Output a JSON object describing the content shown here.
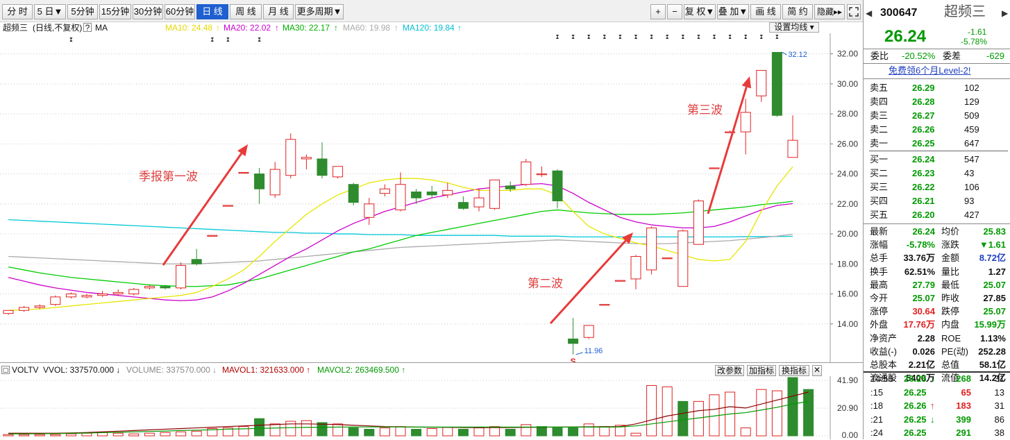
{
  "toolbar": {
    "periods": [
      "分 时",
      "5 日▼",
      "5分钟",
      "15分钟",
      "30分钟",
      "60分钟",
      "日 线",
      "周 线",
      "月 线",
      "更多周期▼"
    ],
    "active_period": "日 线",
    "right_buttons": [
      "+",
      "−",
      "复 权▼",
      "叠 加▼",
      "画 线",
      "简 约",
      "隐藏▸▸"
    ],
    "fullscreen_icon": "fullscreen-icon"
  },
  "chart_header": {
    "name": "超频三",
    "mode": "(日线,不复权)",
    "help": "?",
    "ma_label": "MA",
    "ma10": "MA10: 24.48",
    "ma20": "MA20: 22.02",
    "ma30": "MA30: 22.17",
    "ma60": "MA60: 19.98",
    "ma120": "MA120: 19.84",
    "set_ma": "设置均线"
  },
  "colors": {
    "up": "#e02020",
    "down": "#2e8b2e",
    "ma10": "#e6e600",
    "ma20": "#cc00cc",
    "ma30": "#00cc00",
    "ma60": "#aaaaaa",
    "ma120": "#00c8d8",
    "arrow": "#e83a3a"
  },
  "chart_data": {
    "type": "candlestick",
    "y_ticks": [
      "32.00",
      "30.00",
      "28.00",
      "26.00",
      "24.00",
      "22.00",
      "20.00",
      "18.00",
      "16.00",
      "14.00"
    ],
    "ylim": [
      12.0,
      33.0
    ],
    "candles": [
      {
        "o": 14.7,
        "h": 14.9,
        "l": 14.6,
        "c": 14.9
      },
      {
        "o": 14.9,
        "h": 15.2,
        "l": 14.8,
        "c": 15.1
      },
      {
        "o": 15.1,
        "h": 15.3,
        "l": 15.0,
        "c": 15.2
      },
      {
        "o": 15.3,
        "h": 15.9,
        "l": 15.2,
        "c": 15.8
      },
      {
        "o": 15.8,
        "h": 16.1,
        "l": 15.7,
        "c": 16.0
      },
      {
        "o": 15.8,
        "h": 16.0,
        "l": 15.7,
        "c": 15.9
      },
      {
        "o": 15.9,
        "h": 16.2,
        "l": 15.8,
        "c": 16.0
      },
      {
        "o": 16.0,
        "h": 16.3,
        "l": 15.9,
        "c": 16.1
      },
      {
        "o": 16.0,
        "h": 16.4,
        "l": 15.9,
        "c": 16.3
      },
      {
        "o": 16.4,
        "h": 16.6,
        "l": 16.3,
        "c": 16.5
      },
      {
        "o": 16.5,
        "h": 16.6,
        "l": 16.3,
        "c": 16.4
      },
      {
        "o": 16.4,
        "h": 18.1,
        "l": 16.3,
        "c": 17.9
      },
      {
        "o": 18.3,
        "h": 19.0,
        "l": 17.9,
        "c": 18.0
      },
      {
        "o": 19.9,
        "h": 19.9,
        "l": 19.9,
        "c": 19.9
      },
      {
        "o": 21.9,
        "h": 21.9,
        "l": 21.9,
        "c": 21.9
      },
      {
        "o": 24.1,
        "h": 24.1,
        "l": 24.1,
        "c": 24.1
      },
      {
        "o": 24.0,
        "h": 24.4,
        "l": 22.0,
        "c": 23.0
      },
      {
        "o": 22.6,
        "h": 24.8,
        "l": 22.4,
        "c": 24.3
      },
      {
        "o": 23.9,
        "h": 26.7,
        "l": 23.7,
        "c": 26.3
      },
      {
        "o": 25.0,
        "h": 25.3,
        "l": 24.3,
        "c": 25.1
      },
      {
        "o": 25.0,
        "h": 26.1,
        "l": 23.7,
        "c": 23.9
      },
      {
        "o": 23.8,
        "h": 24.5,
        "l": 23.7,
        "c": 24.5
      },
      {
        "o": 23.3,
        "h": 23.4,
        "l": 21.9,
        "c": 22.1
      },
      {
        "o": 21.1,
        "h": 22.4,
        "l": 20.6,
        "c": 22.0
      },
      {
        "o": 22.7,
        "h": 23.3,
        "l": 22.5,
        "c": 23.0
      },
      {
        "o": 21.6,
        "h": 24.1,
        "l": 21.5,
        "c": 23.3
      },
      {
        "o": 22.8,
        "h": 23.0,
        "l": 22.0,
        "c": 22.4
      },
      {
        "o": 22.8,
        "h": 23.2,
        "l": 22.4,
        "c": 22.6
      },
      {
        "o": 22.6,
        "h": 23.4,
        "l": 22.4,
        "c": 22.9
      },
      {
        "o": 22.1,
        "h": 22.5,
        "l": 21.6,
        "c": 21.7
      },
      {
        "o": 21.8,
        "h": 23.0,
        "l": 21.5,
        "c": 22.4
      },
      {
        "o": 21.7,
        "h": 23.6,
        "l": 21.6,
        "c": 23.6
      },
      {
        "o": 23.2,
        "h": 23.5,
        "l": 22.8,
        "c": 23.0
      },
      {
        "o": 23.3,
        "h": 25.0,
        "l": 23.2,
        "c": 24.8
      },
      {
        "o": 24.0,
        "h": 24.5,
        "l": 23.8,
        "c": 24.0
      },
      {
        "o": 24.2,
        "h": 24.3,
        "l": 21.7,
        "c": 22.2
      },
      {
        "o": 13.0,
        "h": 14.4,
        "l": 11.96,
        "c": 12.7
      },
      {
        "o": 13.1,
        "h": 13.9,
        "l": 13.0,
        "c": 13.9
      },
      {
        "o": 15.3,
        "h": 15.3,
        "l": 15.3,
        "c": 15.3
      },
      {
        "o": 16.9,
        "h": 16.9,
        "l": 16.9,
        "c": 16.9
      },
      {
        "o": 17.0,
        "h": 18.6,
        "l": 16.3,
        "c": 18.5
      },
      {
        "o": 17.6,
        "h": 20.5,
        "l": 17.3,
        "c": 20.4
      },
      {
        "o": 18.4,
        "h": 18.4,
        "l": 18.4,
        "c": 18.4
      },
      {
        "o": 16.5,
        "h": 20.3,
        "l": 16.5,
        "c": 20.2
      },
      {
        "o": 19.3,
        "h": 22.3,
        "l": 19.3,
        "c": 22.2
      },
      {
        "o": 24.4,
        "h": 24.4,
        "l": 24.4,
        "c": 24.4
      },
      {
        "o": 26.8,
        "h": 26.9,
        "l": 26.8,
        "c": 26.8
      },
      {
        "o": 26.8,
        "h": 29.0,
        "l": 25.3,
        "c": 28.1
      },
      {
        "o": 29.2,
        "h": 30.9,
        "l": 28.8,
        "c": 30.9
      },
      {
        "o": 32.1,
        "h": 32.12,
        "l": 27.8,
        "c": 27.9
      },
      {
        "o": 25.1,
        "h": 27.9,
        "l": 25.1,
        "c": 26.24
      }
    ],
    "ma10": [
      14.9,
      14.95,
      15.0,
      15.1,
      15.2,
      15.3,
      15.4,
      15.5,
      15.6,
      15.7,
      15.8,
      15.9,
      16.1,
      16.5,
      17.0,
      17.6,
      18.5,
      19.5,
      20.4,
      21.3,
      22.0,
      22.6,
      23.0,
      23.4,
      23.6,
      23.7,
      23.7,
      23.6,
      23.4,
      23.1,
      22.9,
      22.9,
      22.9,
      23.0,
      23.0,
      22.6,
      21.5,
      20.5,
      20.0,
      19.7,
      19.4,
      19.2,
      18.9,
      18.6,
      18.3,
      18.2,
      18.3,
      19.5,
      21.5,
      23.2,
      24.48
    ],
    "ma20": [
      17.1,
      16.85,
      16.6,
      16.4,
      16.25,
      16.1,
      16.0,
      15.9,
      15.8,
      15.7,
      15.6,
      15.55,
      15.6,
      15.8,
      16.2,
      16.7,
      17.3,
      17.9,
      18.5,
      19.0,
      19.6,
      20.2,
      20.7,
      21.1,
      21.5,
      21.8,
      22.1,
      22.4,
      22.6,
      22.8,
      23.0,
      23.1,
      23.2,
      23.3,
      23.35,
      23.2,
      22.7,
      22.1,
      21.6,
      21.1,
      20.8,
      20.6,
      20.5,
      20.4,
      20.4,
      20.5,
      20.8,
      21.2,
      21.6,
      21.9,
      22.02
    ],
    "ma30": [
      17.8,
      17.6,
      17.4,
      17.25,
      17.1,
      17.0,
      16.9,
      16.8,
      16.7,
      16.6,
      16.55,
      16.5,
      16.5,
      16.55,
      16.6,
      16.8,
      17.0,
      17.3,
      17.6,
      17.9,
      18.2,
      18.5,
      18.8,
      19.0,
      19.3,
      19.6,
      19.9,
      20.1,
      20.3,
      20.5,
      20.7,
      20.9,
      21.1,
      21.3,
      21.5,
      21.6,
      21.5,
      21.4,
      21.35,
      21.3,
      21.3,
      21.3,
      21.35,
      21.4,
      21.5,
      21.6,
      21.7,
      21.8,
      21.95,
      22.05,
      22.17
    ],
    "ma60": [
      18.5,
      18.45,
      18.4,
      18.35,
      18.3,
      18.25,
      18.2,
      18.15,
      18.1,
      18.05,
      18.0,
      18.0,
      18.0,
      18.05,
      18.1,
      18.15,
      18.2,
      18.3,
      18.4,
      18.5,
      18.6,
      18.7,
      18.8,
      18.9,
      19.0,
      19.1,
      19.15,
      19.2,
      19.25,
      19.3,
      19.35,
      19.4,
      19.45,
      19.5,
      19.55,
      19.6,
      19.55,
      19.5,
      19.45,
      19.4,
      19.35,
      19.35,
      19.35,
      19.4,
      19.45,
      19.5,
      19.55,
      19.65,
      19.75,
      19.85,
      19.98
    ],
    "ma120": [
      20.95,
      20.9,
      20.85,
      20.8,
      20.75,
      20.7,
      20.65,
      20.6,
      20.55,
      20.5,
      20.45,
      20.4,
      20.35,
      20.3,
      20.25,
      20.2,
      20.15,
      20.1,
      20.1,
      20.05,
      20.05,
      20.0,
      20.0,
      19.95,
      19.95,
      19.95,
      19.9,
      19.9,
      19.9,
      19.9,
      19.9,
      19.9,
      19.85,
      19.85,
      19.85,
      19.85,
      19.8,
      19.8,
      19.8,
      19.8,
      19.8,
      19.8,
      19.8,
      19.8,
      19.8,
      19.8,
      19.8,
      19.82,
      19.82,
      19.83,
      19.84
    ],
    "high_label": "32.12",
    "low_label": "11.96",
    "annotations": [
      "季报第一波",
      "第二波",
      "第三波"
    ],
    "volume": {
      "y_ticks": [
        "41.90",
        "20.90",
        "0.00"
      ],
      "ylim": [
        0,
        44
      ],
      "values": [
        1,
        1,
        1,
        1,
        1.5,
        2,
        2.5,
        2,
        1.5,
        2,
        2.5,
        3,
        3.5,
        5.5,
        6,
        7,
        13,
        9,
        11,
        11.5,
        10,
        9,
        6,
        5,
        6,
        7,
        5,
        5.5,
        6.5,
        5,
        6,
        7,
        5,
        8.5,
        7,
        6,
        6,
        9,
        7,
        8,
        2,
        38,
        37,
        26,
        26,
        31,
        33,
        6,
        35,
        34,
        44,
        35
      ],
      "ups": [
        true,
        true,
        true,
        true,
        true,
        true,
        true,
        true,
        true,
        true,
        true,
        true,
        true,
        true,
        true,
        true,
        false,
        true,
        true,
        true,
        false,
        true,
        false,
        false,
        true,
        true,
        false,
        true,
        true,
        false,
        true,
        true,
        false,
        true,
        false,
        false,
        false,
        true,
        true,
        true,
        true,
        true,
        true,
        false,
        true,
        true,
        true,
        true,
        true,
        true,
        false,
        false
      ],
      "mavol1": [
        2,
        2,
        2,
        2,
        2.2,
        2.5,
        3,
        3.5,
        4,
        4.5,
        5,
        5.5,
        6,
        6.5,
        7,
        7.5,
        8,
        8.5,
        9,
        9,
        8.8,
        8.5,
        8,
        7.5,
        7,
        6.8,
        6.6,
        6.5,
        6.4,
        6.3,
        6.2,
        6.2,
        6.3,
        6.4,
        6.5,
        6.6,
        6.7,
        6.8,
        6.9,
        7,
        9,
        12,
        15,
        17,
        19,
        20,
        22,
        21,
        24,
        27,
        30,
        33
      ],
      "mavol2": [
        1.5,
        1.5,
        1.6,
        1.7,
        1.9,
        2.1,
        2.4,
        2.7,
        3,
        3.3,
        3.6,
        4,
        4.3,
        4.6,
        5,
        5.3,
        5.6,
        5.9,
        6.2,
        6.4,
        6.5,
        6.6,
        6.7,
        6.7,
        6.7,
        6.7,
        6.6,
        6.6,
        6.6,
        6.6,
        6.6,
        6.6,
        6.6,
        6.6,
        6.6,
        6.6,
        6.6,
        6.6,
        6.6,
        6.7,
        7.5,
        9,
        10.5,
        12,
        13.5,
        15,
        16.5,
        17.5,
        19.5,
        21.5,
        24,
        26
      ]
    }
  },
  "volume_header": {
    "name": "VOLTV",
    "vvol": "VVOL: 337570.000 ↓",
    "volume": "VOLUME: 337570.000 ↓",
    "mavol1": "MAVOL1: 321633.000 ↑",
    "mavol2": "MAVOL2: 263469.500 ↑",
    "buttons": [
      "改参数",
      "加指标",
      "换指标"
    ]
  },
  "quote": {
    "code": "300647",
    "name": "超频三",
    "price": "26.24",
    "change": "-1.61",
    "change_pct": "-5.78%",
    "webi_label": "委比",
    "webi": "-20.52%",
    "weicha_label": "委差",
    "weicha": "-629",
    "promo": "免费领6个月Level-2!",
    "sells": [
      {
        "label": "卖五",
        "price": "26.29",
        "vol": "102"
      },
      {
        "label": "卖四",
        "price": "26.28",
        "vol": "129"
      },
      {
        "label": "卖三",
        "price": "26.27",
        "vol": "509"
      },
      {
        "label": "卖二",
        "price": "26.26",
        "vol": "459"
      },
      {
        "label": "卖一",
        "price": "26.25",
        "vol": "647"
      }
    ],
    "buys": [
      {
        "label": "买一",
        "price": "26.24",
        "vol": "547"
      },
      {
        "label": "买二",
        "price": "26.23",
        "vol": "43"
      },
      {
        "label": "买三",
        "price": "26.22",
        "vol": "106"
      },
      {
        "label": "买四",
        "price": "26.21",
        "vol": "93"
      },
      {
        "label": "买五",
        "price": "26.20",
        "vol": "427"
      }
    ],
    "stats": [
      {
        "l1": "最新",
        "v1": "26.24",
        "c1": "green",
        "l2": "均价",
        "v2": "25.83",
        "c2": "green"
      },
      {
        "l1": "涨幅",
        "v1": "-5.78%",
        "c1": "green",
        "l2": "涨跌",
        "v2": "▼1.61",
        "c2": "green"
      },
      {
        "l1": "总手",
        "v1": "33.76万",
        "c1": "",
        "l2": "金额",
        "v2": "8.72亿",
        "c2": "blue"
      },
      {
        "l1": "换手",
        "v1": "62.51%",
        "c1": "",
        "l2": "量比",
        "v2": "1.27",
        "c2": ""
      },
      {
        "l1": "最高",
        "v1": "27.79",
        "c1": "green",
        "l2": "最低",
        "v2": "25.07",
        "c2": "green"
      },
      {
        "l1": "今开",
        "v1": "25.07",
        "c1": "green",
        "l2": "昨收",
        "v2": "27.85",
        "c2": ""
      },
      {
        "l1": "涨停",
        "v1": "30.64",
        "c1": "red",
        "l2": "跌停",
        "v2": "25.07",
        "c2": "green"
      },
      {
        "l1": "外盘",
        "v1": "17.76万",
        "c1": "red",
        "l2": "内盘",
        "v2": "15.99万",
        "c2": "green"
      },
      {
        "l1": "净资产",
        "v1": "2.28",
        "c1": "",
        "l2": "ROE",
        "v2": "1.13%",
        "c2": ""
      },
      {
        "l1": "收益(-)",
        "v1": "0.026",
        "c1": "",
        "l2": "PE(动)",
        "v2": "252.28",
        "c2": ""
      },
      {
        "l1": "总股本",
        "v1": "2.21亿",
        "c1": "",
        "l2": "总值",
        "v2": "58.1亿",
        "c2": ""
      },
      {
        "l1": "流通股",
        "v1": "5400万",
        "c1": "",
        "l2": "流值",
        "v2": "14.2亿",
        "c2": ""
      }
    ],
    "ticks": [
      {
        "time": "14:56",
        "price": "26.25",
        "dir": "↓",
        "dc": "green",
        "vol": "268",
        "vc": "green",
        "n": "31"
      },
      {
        "time": ":15",
        "price": "26.25",
        "dir": "",
        "dc": "",
        "vol": "65",
        "vc": "red",
        "n": "13"
      },
      {
        "time": ":18",
        "price": "26.26",
        "dir": "↑",
        "dc": "red",
        "vol": "183",
        "vc": "red",
        "n": "31"
      },
      {
        "time": ":21",
        "price": "26.25",
        "dir": "↓",
        "dc": "green",
        "vol": "399",
        "vc": "green",
        "n": "86"
      },
      {
        "time": ":24",
        "price": "26.25",
        "dir": "",
        "dc": "",
        "vol": "291",
        "vc": "green",
        "n": "38"
      }
    ]
  }
}
